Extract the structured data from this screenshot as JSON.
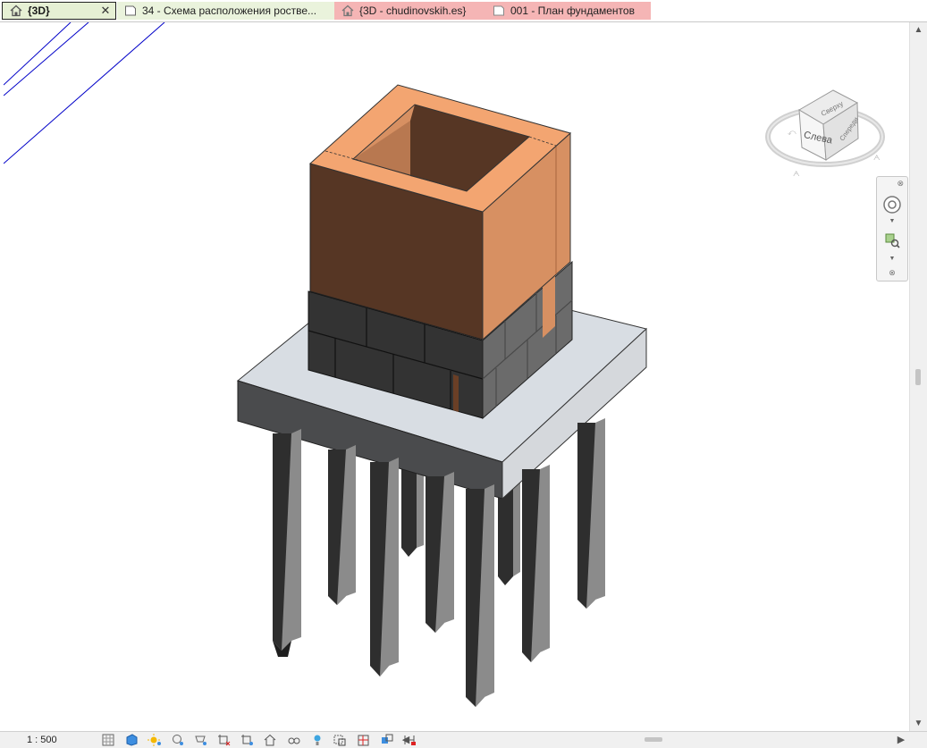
{
  "tabs": [
    {
      "label": "{3D}",
      "icon": "home-icon",
      "active": true
    },
    {
      "label": "34 - Схема расположения ростве...",
      "icon": "sheet-icon"
    },
    {
      "label": "{3D - chudinovskih.es}",
      "icon": "home-icon"
    },
    {
      "label": "001 - План фундаментов",
      "icon": "plan-icon"
    }
  ],
  "viewcube": {
    "face_label": "Слева",
    "top_label": "Сверху",
    "right_label": "Спереди"
  },
  "status": {
    "scale": "1 : 500"
  },
  "colors": {
    "accent": "#1e6fd0",
    "wall_brown": "#563624",
    "wall_light": "#d79062",
    "wall_top": "#f3a571",
    "block_dark": "#333333",
    "slab_top": "#d8dde3",
    "slab_side": "#4a4b4d",
    "pile": "#2e2e2e",
    "guide_lines": "#0000c8",
    "tab_active": "#e6f0d4",
    "tab_red": "#f5b5b5"
  }
}
